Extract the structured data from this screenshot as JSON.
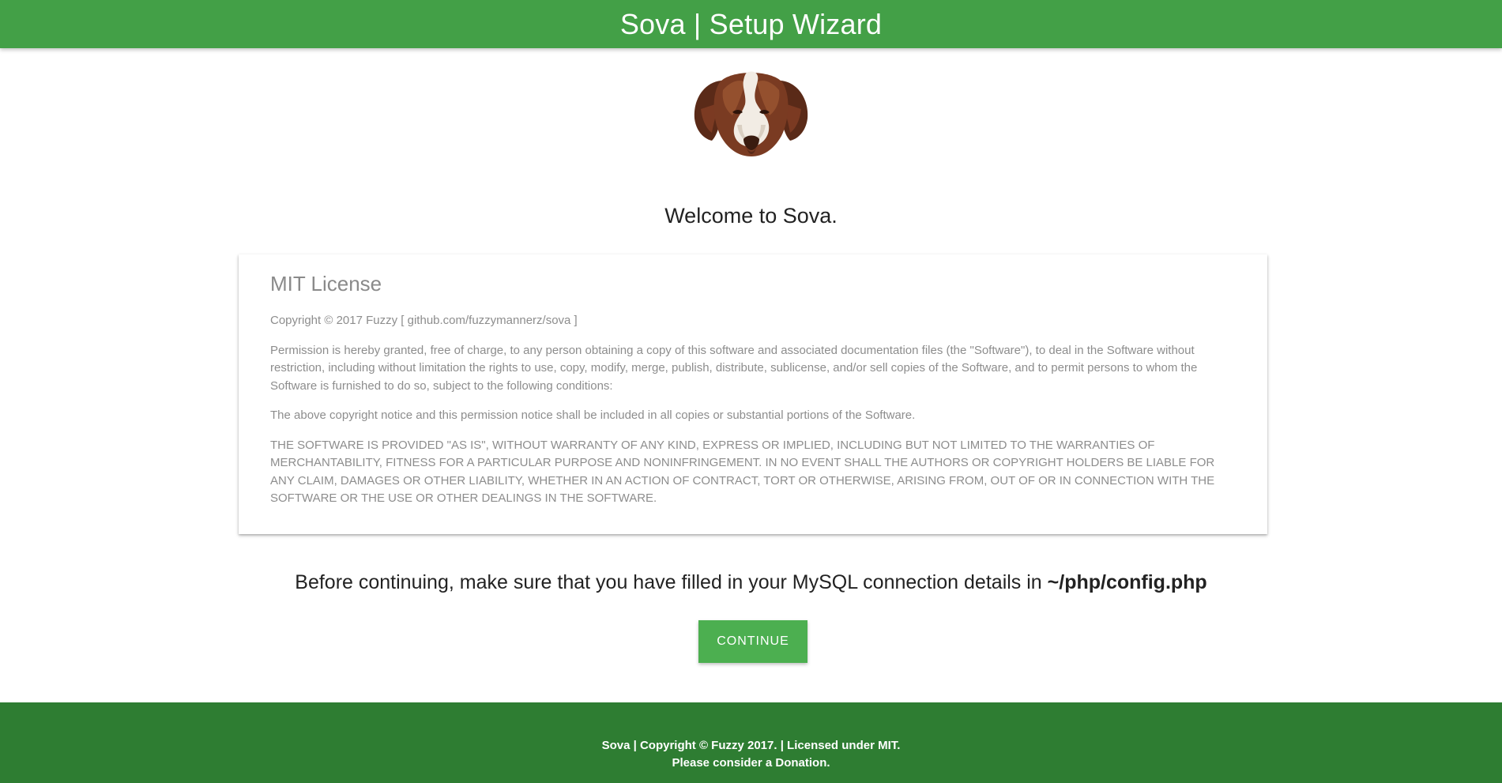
{
  "header": {
    "title": "Sova | Setup Wizard"
  },
  "logo": {
    "icon": "dog-head-logo"
  },
  "welcome": "Welcome to Sova.",
  "license": {
    "title": "MIT License",
    "paragraphs": [
      "Copyright © 2017 Fuzzy [ github.com/fuzzymannerz/sova ]",
      "Permission is hereby granted, free of charge, to any person obtaining a copy of this software and associated documentation files (the \"Software\"), to deal in the Software without restriction, including without limitation the rights to use, copy, modify, merge, publish, distribute, sublicense, and/or sell copies of the Software, and to permit persons to whom the Software is furnished to do so, subject to the following conditions:",
      "The above copyright notice and this permission notice shall be included in all copies or substantial portions of the Software.",
      "THE SOFTWARE IS PROVIDED \"AS IS\", WITHOUT WARRANTY OF ANY KIND, EXPRESS OR IMPLIED, INCLUDING BUT NOT LIMITED TO THE WARRANTIES OF MERCHANTABILITY, FITNESS FOR A PARTICULAR PURPOSE AND NONINFRINGEMENT. IN NO EVENT SHALL THE AUTHORS OR COPYRIGHT HOLDERS BE LIABLE FOR ANY CLAIM, DAMAGES OR OTHER LIABILITY, WHETHER IN AN ACTION OF CONTRACT, TORT OR OTHERWISE, ARISING FROM, OUT OF OR IN CONNECTION WITH THE SOFTWARE OR THE USE OR OTHER DEALINGS IN THE SOFTWARE."
    ]
  },
  "notice": {
    "text": "Before continuing, make sure that you have filled in your MySQL connection details in ",
    "path": "~/php/config.php"
  },
  "continue_label": "CONTINUE",
  "footer": {
    "line1": "Sova | Copyright © Fuzzy 2017. | Licensed under MIT.",
    "line2": "Please consider a Donation."
  },
  "colors": {
    "header_bg": "#43a047",
    "button_bg": "#4caf50",
    "footer_bg": "#2e7d32"
  }
}
